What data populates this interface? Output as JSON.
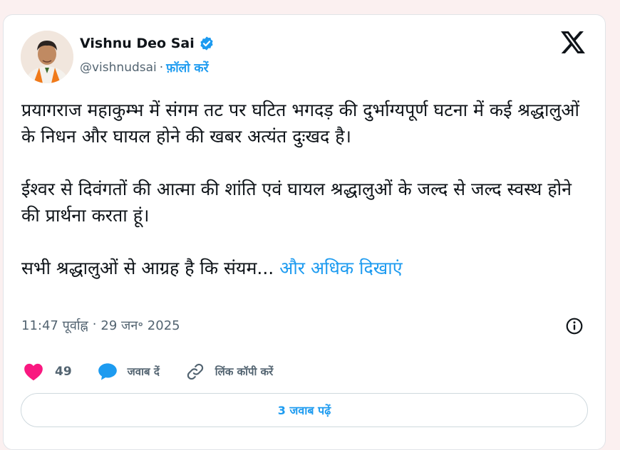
{
  "author": {
    "name": "Vishnu Deo Sai",
    "handle": "@vishnudsai",
    "separator": "·",
    "follow_label": "फ़ॉलो करें",
    "verified": true
  },
  "tweet": {
    "paragraphs": [
      "प्रयागराज महाकुम्भ में संगम तट पर घटित भगदड़ की दुर्भाग्यपूर्ण घटना में कई श्रद्धालुओं के निधन और घायल होने की खबर अत्यंत दुःखद है।",
      "ईश्वर से दिवंगतों की आत्मा की शांति एवं घायल श्रद्धालुओं के जल्द से जल्द स्वस्थ होने की प्रार्थना करता हूं।"
    ],
    "truncated_text": "सभी श्रद्धालुओं से आग्रह है कि संयम...",
    "show_more_label": "और अधिक दिखाएं",
    "time": "11:47 पूर्वाह्न",
    "date_separator": "·",
    "date": "29 जन॰ 2025"
  },
  "actions": {
    "like_count": "49",
    "reply_label": "जवाब दें",
    "copy_link_label": "लिंक कॉपी करें"
  },
  "replies_button_label": "3 जवाब पढ़ें",
  "icons": {
    "brand": "x-logo-icon",
    "verified": "verified-badge-icon",
    "info": "info-icon",
    "like": "heart-icon",
    "reply": "speech-bubble-icon",
    "copy_link": "link-icon"
  },
  "colors": {
    "accent": "#1d9bf0",
    "like": "#f91880",
    "text": "#0f1419",
    "muted": "#536471"
  }
}
